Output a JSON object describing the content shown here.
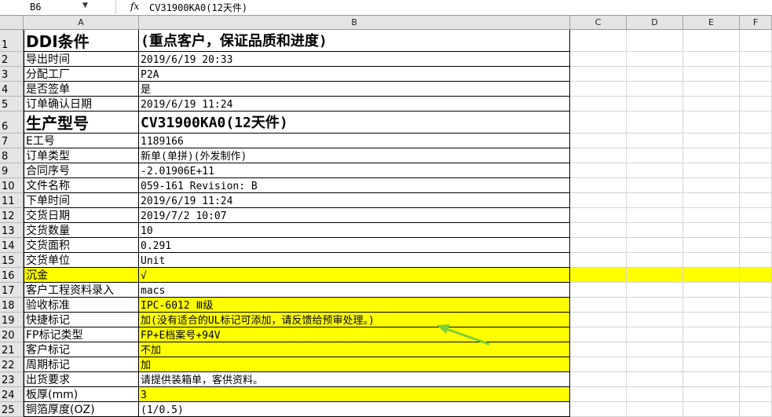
{
  "namebox": "B6",
  "fx": "fx",
  "formula": "CV31900KA0(12天件)",
  "columns": [
    "A",
    "B",
    "C",
    "D",
    "E",
    "F"
  ],
  "rows": [
    {
      "n": "1",
      "a": "DDI条件",
      "b": "(重点客户，保证品质和进度)",
      "big": true
    },
    {
      "n": "2",
      "a": "导出时间",
      "b": "2019/6/19 20:33"
    },
    {
      "n": "3",
      "a": "分配工厂",
      "b": "P2A"
    },
    {
      "n": "4",
      "a": "是否签单",
      "b": "是"
    },
    {
      "n": "5",
      "a": "订单确认日期",
      "b": "2019/6/19 11:24"
    },
    {
      "n": "6",
      "a": "生产型号",
      "b": "CV31900KA0(12天件)",
      "big": true
    },
    {
      "n": "7",
      "a": "E工号",
      "b": "1189166"
    },
    {
      "n": "8",
      "a": "订单类型",
      "b": "新单(单拼)(外发制作)"
    },
    {
      "n": "9",
      "a": "合同序号",
      "b": "-2.01906E+11"
    },
    {
      "n": "10",
      "a": "文件名称",
      "b": "059-161 Revision: B"
    },
    {
      "n": "11",
      "a": "下单时间",
      "b": "2019/6/19 11:24"
    },
    {
      "n": "12",
      "a": "交货日期",
      "b": "2019/7/2 10:07"
    },
    {
      "n": "13",
      "a": "交货数量",
      "b": "10"
    },
    {
      "n": "14",
      "a": "交货面积",
      "b": "0.291"
    },
    {
      "n": "15",
      "a": "交货单位",
      "b": "Unit"
    },
    {
      "n": "16",
      "a": "沉金",
      "b": "√",
      "hl": "full"
    },
    {
      "n": "17",
      "a": "客户工程资料录入",
      "b": "macs"
    },
    {
      "n": "18",
      "a": "验收标准",
      "b": "IPC-6012 Ⅲ级",
      "hl": "b"
    },
    {
      "n": "19",
      "a": "快捷标记",
      "b": "加(没有适合的UL标记可添加，请反馈给预审处理。)",
      "hl": "b"
    },
    {
      "n": "20",
      "a": "FP标记类型",
      "b": "FP+E档案号+94V",
      "hl": "b"
    },
    {
      "n": "21",
      "a": "客户标记",
      "b": "不加",
      "hl": "b"
    },
    {
      "n": "22",
      "a": "周期标记",
      "b": "加",
      "hl": "b"
    },
    {
      "n": "23",
      "a": "出货要求",
      "b": "请提供装箱单，客供资料。"
    },
    {
      "n": "24",
      "a": "板厚(mm)",
      "b": "3",
      "hl": "b"
    },
    {
      "n": "25",
      "a": "铜箔厚度(OZ)",
      "b": "(1/0.5)"
    }
  ],
  "colors": {
    "highlight": "#ffff00",
    "header": "#e4e4e4",
    "arrow": "#7ccf3a"
  }
}
